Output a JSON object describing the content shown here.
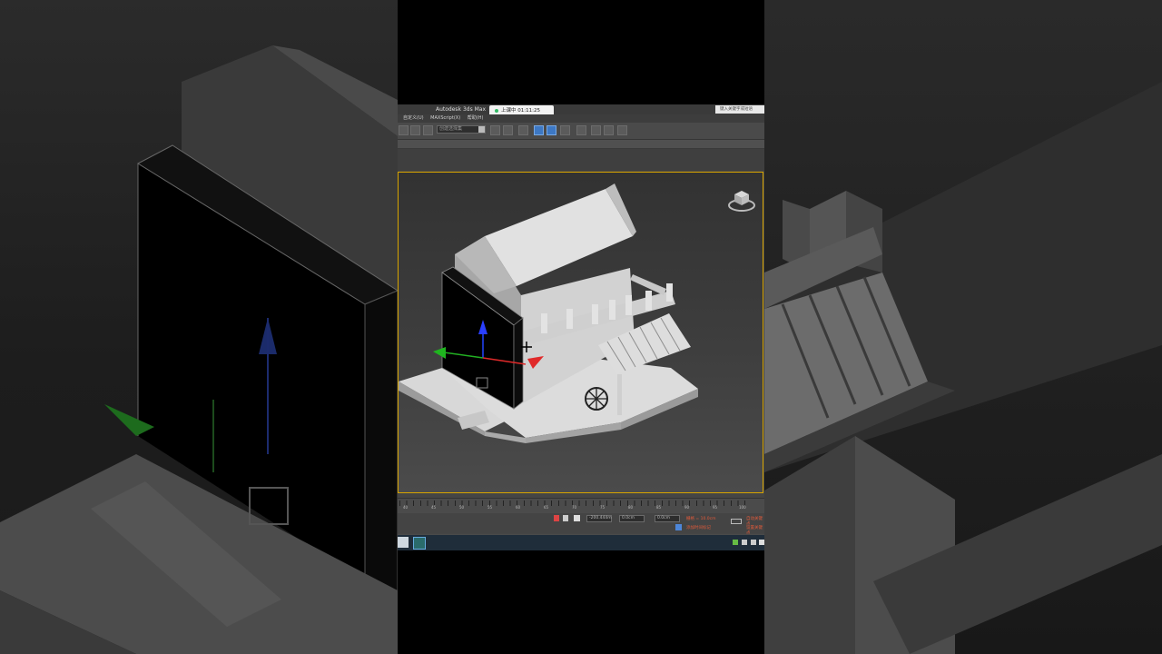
{
  "window": {
    "app_title": "Autodesk 3ds Max",
    "recording_label": "上课中 01:11:25",
    "help_search_placeholder": "键入关键字或短语"
  },
  "menubar": {
    "items": [
      "自定义(U)",
      "MAXScript(X)",
      "帮助(H)"
    ]
  },
  "toolbar": {
    "selection_set_value": "创建选择集"
  },
  "timeline": {
    "tick_labels": [
      "40",
      "45",
      "50",
      "55",
      "60",
      "65",
      "70",
      "75",
      "80",
      "85",
      "90",
      "95",
      "100"
    ]
  },
  "statusbar": {
    "x_value": "-200.444m",
    "y_value": "0.0cm",
    "z_value": "0.0cm",
    "grid_value": "栅格 = 10.0cm",
    "add_time_tag": "添加时间标记",
    "auto_key": "自动关键点",
    "set_key": "设置关键点"
  },
  "colors": {
    "accent_blue": "#3d78c4",
    "viewport_border": "#d7a400",
    "gizmo_x": "#e02a2a",
    "gizmo_y": "#22b022",
    "gizmo_z": "#2244ff"
  }
}
